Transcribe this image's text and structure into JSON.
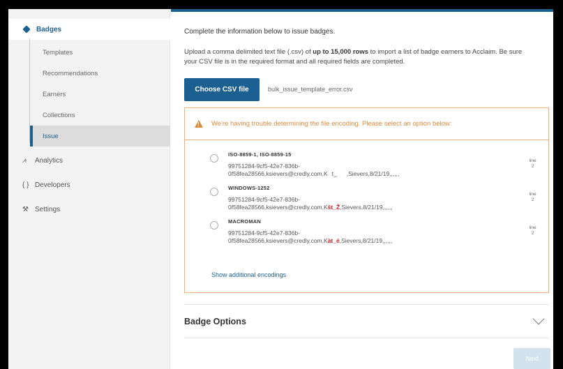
{
  "sidebar": {
    "badges": "Badges",
    "sub_items": [
      "Templates",
      "Recommendations",
      "Earners",
      "Collections",
      "Issue"
    ],
    "analytics": "Analytics",
    "developers": "Developers",
    "settings": "Settings"
  },
  "main": {
    "intro": "Complete the information below to issue badges.",
    "upload_pre": "Upload a comma delimited text file (.csv) of ",
    "upload_bold": "up to 15,000 rows",
    "upload_post": " to import a list of badge earners to Acclaim. Be sure your CSV file is in the required format and all required fields are completed.",
    "choose_button": "Choose CSV file",
    "filename": "bulk_issue_template_error.csv",
    "warning": "We're having trouble determining the file encoding. Please select an option below:",
    "encodings": [
      {
        "title": "ISO-8859-1, ISO-8859-15",
        "line1": "99751284-9cf5-42e7-836b-",
        "line2_pre": "0f58fea28566,ksievers@credly.com,K",
        "line2_mark": "t_",
        "line2_post": ",Sievers,8/21/19,,,,,,",
        "side": "line 2"
      },
      {
        "title": "WINDOWS-1252",
        "line1": "99751284-9cf5-42e7-836b-",
        "line2_pre": "0f58fea28566,ksievers@credly.com,K",
        "line2_mark": "št_Ž",
        "line2_post": ",Sievers,8/21/19,,,,,,",
        "side": "line 2"
      },
      {
        "title": "MACROMAN",
        "line1": "99751284-9cf5-42e7-836b-",
        "line2_pre": "0f58fea28566,ksievers@credly.com,K",
        "line2_mark": "àt_é",
        "line2_post": ",Sievers,8/21/19,,,,,,",
        "side": "line 2"
      }
    ],
    "show_more": "Show additional encodings",
    "badge_options": "Badge Options",
    "next": "Next"
  },
  "colors": {
    "accent": "#1c5f91",
    "warning": "#e08b3e"
  }
}
